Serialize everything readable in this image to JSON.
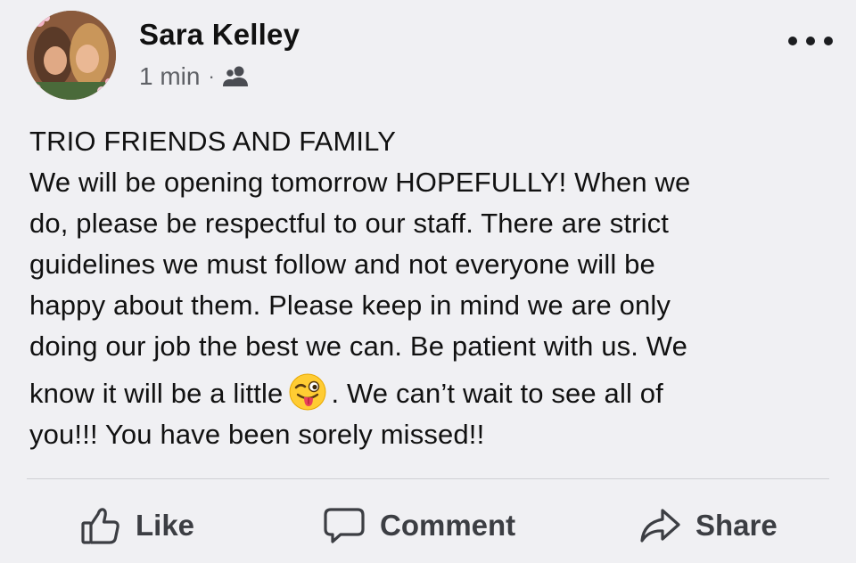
{
  "post": {
    "author": "Sara Kelley",
    "time": "1 min",
    "separator": "·",
    "audience_icon": "friends-icon",
    "text_lines": [
      "TRIO FRIENDS AND FAMILY",
      "We will be opening tomorrow HOPEFULLY! When we",
      "do, please be respectful to our staff. There are strict",
      "guidelines we must follow and not everyone will be",
      "happy about them. Please keep in mind we are only",
      "doing our job the best we can. Be patient with us. We"
    ],
    "line7_before_emoji": "know it will be a little",
    "emoji": "winking-face-with-tongue",
    "line7_after_emoji": ". We can’t wait to see all of",
    "line8": "you!!! You have been sorely missed!!"
  },
  "actions": {
    "like_label": "Like",
    "comment_label": "Comment",
    "share_label": "Share"
  },
  "colors": {
    "background": "#f0f0f3",
    "text": "#111111",
    "meta": "#5f6166",
    "action": "#3c3e43"
  }
}
